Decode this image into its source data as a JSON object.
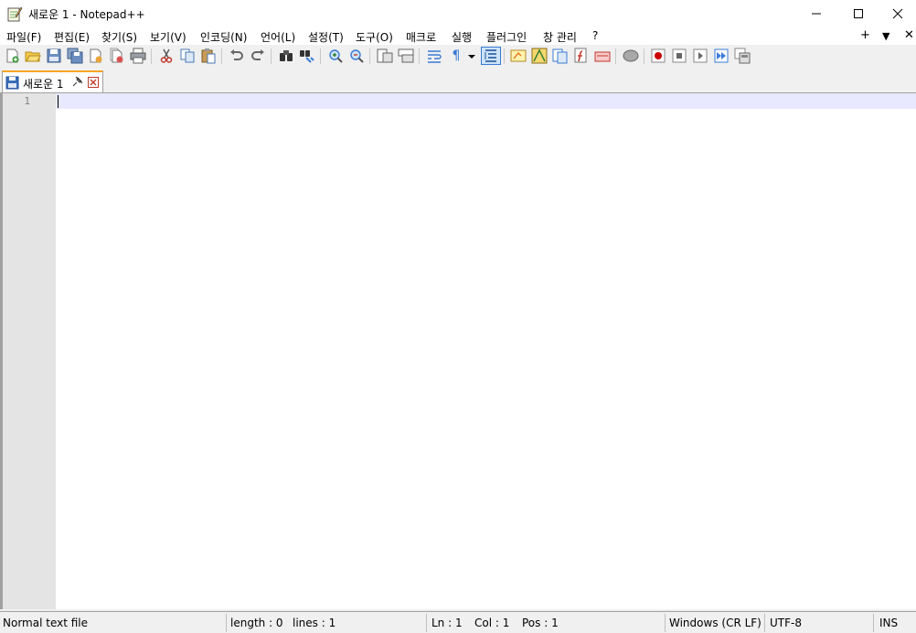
{
  "window": {
    "title": "새로운 1 - Notepad++",
    "controls": {
      "minimize_icon": "minimize-icon",
      "maximize_icon": "maximize-icon",
      "close_icon": "close-icon"
    }
  },
  "menu": {
    "items": [
      "파일(F)",
      "편집(E)",
      "찾기(S)",
      "보기(V)",
      "인코딩(N)",
      "언어(L)",
      "설정(T)",
      "도구(O)",
      "매크로",
      "실행",
      "플러그인",
      "창 관리",
      "?"
    ],
    "right": {
      "add": "+",
      "dropdown": "▼",
      "close": "✕"
    }
  },
  "toolbar": {
    "buttons": [
      "new-file-icon",
      "open-file-icon",
      "save-icon",
      "save-all-icon",
      "close-icon",
      "close-all-icon",
      "print-icon",
      "cut-icon",
      "copy-icon",
      "paste-icon",
      "undo-icon",
      "redo-icon",
      "find-icon",
      "replace-icon",
      "zoom-in-icon",
      "zoom-out-icon",
      "sync-vertical-icon",
      "sync-horizontal-icon",
      "word-wrap-icon",
      "show-all-chars-icon",
      "indent-guide-icon",
      "user-lang-icon",
      "doc-map-icon",
      "doc-list-icon",
      "function-list-icon",
      "folder-workspace-icon",
      "monitoring-icon",
      "record-macro-icon",
      "stop-record-icon",
      "play-macro-icon",
      "run-macro-multiple-icon",
      "save-macro-icon"
    ],
    "pilcrow": "¶"
  },
  "tabs": [
    {
      "label": "새로운 1",
      "active": true
    }
  ],
  "editor": {
    "line_numbers": [
      "1"
    ],
    "current_line_color": "#e8e8ff"
  },
  "status": {
    "file_type": "Normal text file",
    "length": "length : 0",
    "lines": "lines : 1",
    "ln": "Ln : 1",
    "col": "Col : 1",
    "pos": "Pos : 1",
    "eol": "Windows (CR LF)",
    "encoding": "UTF-8",
    "mode": "INS"
  },
  "colors": {
    "accent_tab": "#f5a623",
    "gutter": "#e4e4e4"
  }
}
